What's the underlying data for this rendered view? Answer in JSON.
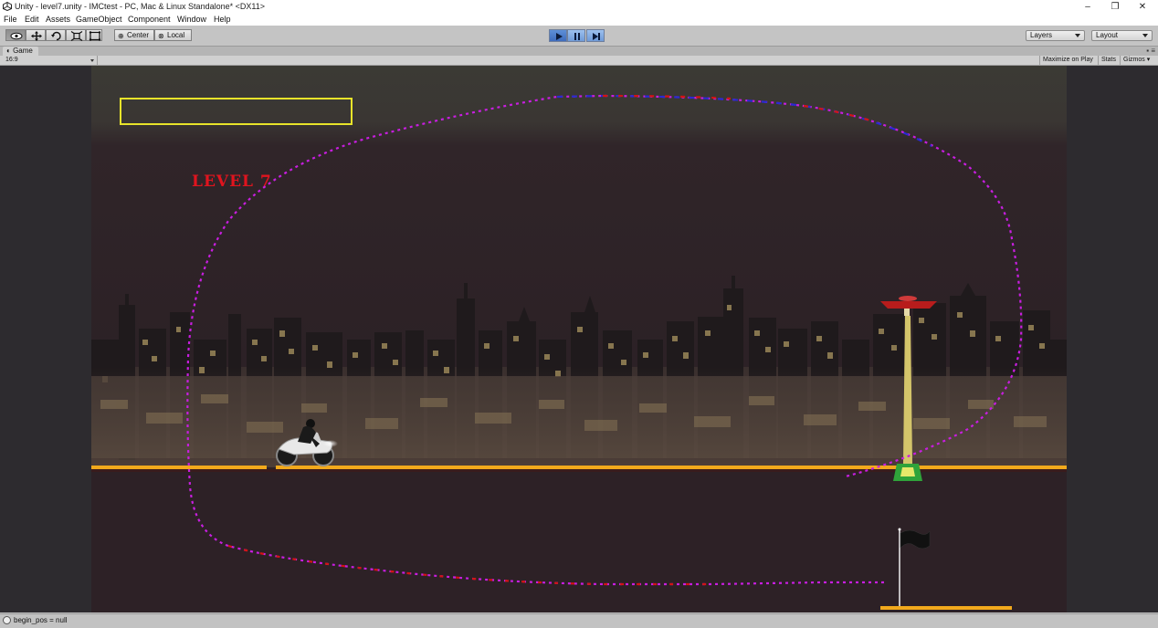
{
  "window": {
    "title": "Unity - level7.unity - IMCtest - PC, Mac & Linux Standalone* <DX11>",
    "minimize_glyph": "–",
    "restore_glyph": "❐",
    "close_glyph": "✕"
  },
  "menu": {
    "items": [
      "File",
      "Edit",
      "Assets",
      "GameObject",
      "Component",
      "Window",
      "Help"
    ]
  },
  "toolbar": {
    "tools": [
      "view-tool",
      "move-tool",
      "rotate-tool",
      "scale-tool",
      "rect-tool"
    ],
    "pivot_center": "Center",
    "pivot_local": "Local",
    "layers_label": "Layers",
    "layout_label": "Layout"
  },
  "game_tab": {
    "label": "Game",
    "aspect": "16:9",
    "maximize_on_play": "Maximize on Play",
    "stats": "Stats",
    "gizmos": "Gizmos"
  },
  "game": {
    "level_text": "LEVEL 7",
    "colors": {
      "hud_box": "#e8e42a",
      "level_text": "#e0141e",
      "road": "#f2a91c",
      "trajectory_a": "#c81ee0",
      "trajectory_b": "#d21414",
      "trajectory_c": "#2a2ad2",
      "lamp_head": "#b81c1c",
      "lamp_base": "#2fa33a"
    }
  },
  "status": {
    "message": "begin_pos = null"
  }
}
